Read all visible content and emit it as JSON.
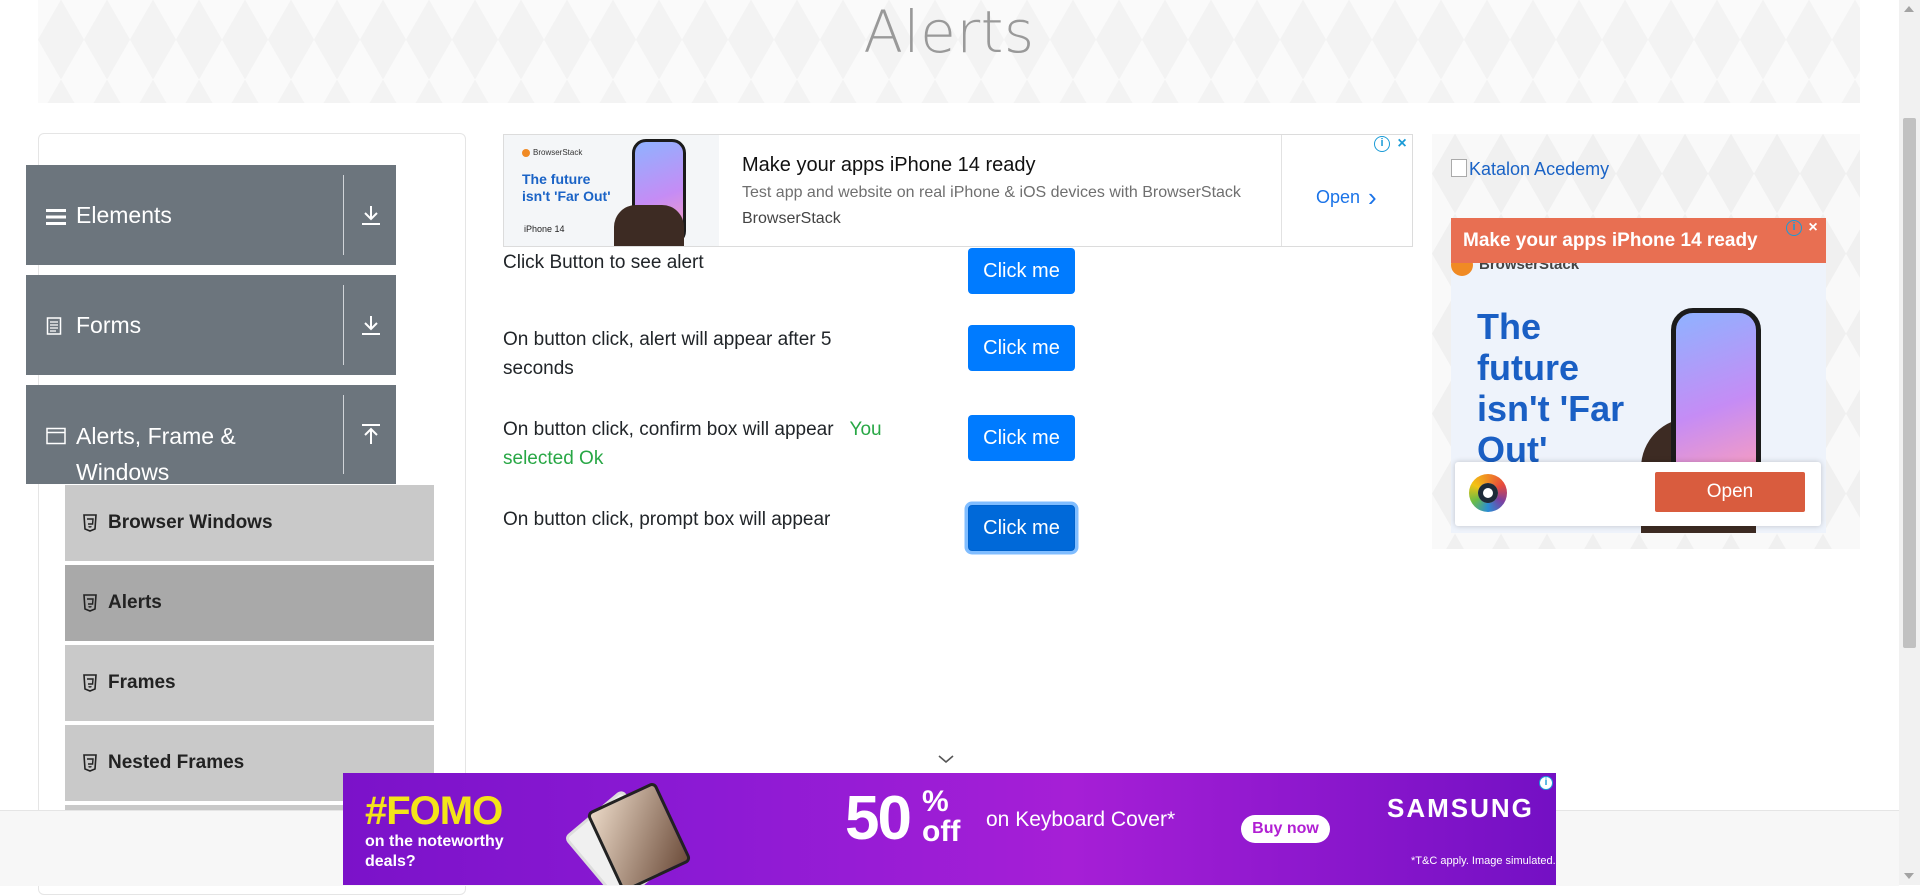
{
  "header": {
    "title": "Alerts"
  },
  "sidebar": {
    "groups": [
      {
        "label": "Elements",
        "icon": "hamburger-icon",
        "arrow": "download-arrow-icon"
      },
      {
        "label": "Forms",
        "icon": "document-icon",
        "arrow": "download-arrow-icon"
      },
      {
        "label": "Alerts, Frame & Windows",
        "icon": "window-icon",
        "arrow": "upload-arrow-icon"
      }
    ],
    "items": [
      {
        "label": "Browser Windows",
        "active": false
      },
      {
        "label": "Alerts",
        "active": true
      },
      {
        "label": "Frames",
        "active": false
      },
      {
        "label": "Nested Frames",
        "active": false
      }
    ]
  },
  "ad_top": {
    "brand": "BrowserStack",
    "tagline": "The future isn't 'Far Out'",
    "product": "iPhone 14",
    "headline": "Make your apps iPhone 14 ready",
    "description": "Test app and website on real iPhone & iOS devices with BrowserStack",
    "advertiser": "BrowserStack",
    "cta": "Open"
  },
  "alerts": {
    "rows": [
      {
        "text": "Click Button to see alert",
        "result": "",
        "button": "Click me"
      },
      {
        "text": "On button click, alert will appear after 5 seconds",
        "result": "",
        "button": "Click me"
      },
      {
        "text": "On button click, confirm box will appear",
        "result": "You selected Ok",
        "button": "Click me"
      },
      {
        "text": "On button click, prompt box will appear",
        "result": "",
        "button": "Click me"
      }
    ]
  },
  "ad_right": {
    "image_alt": "Katalon Acedemy",
    "headline": "Make your apps iPhone 14 ready",
    "brand": "BrowserStack",
    "tagline": "The future isn't 'Far Out'",
    "cta": "Open"
  },
  "ad_bottom": {
    "fomo": "#FOMO",
    "fomo_sub": "on the noteworthy deals?",
    "discount": "50",
    "percent_off": "% off",
    "product": "on Keyboard Cover*",
    "cta": "Buy now",
    "brand": "SAMSUNG",
    "disclaimer": "*T&C apply. Image simulated."
  },
  "colors": {
    "primary_button": "#007bff",
    "sidebar_header": "#6c757d",
    "menu_item": "#c9c9c9",
    "menu_item_active": "#a9a9a9",
    "success_text": "#28a745"
  }
}
